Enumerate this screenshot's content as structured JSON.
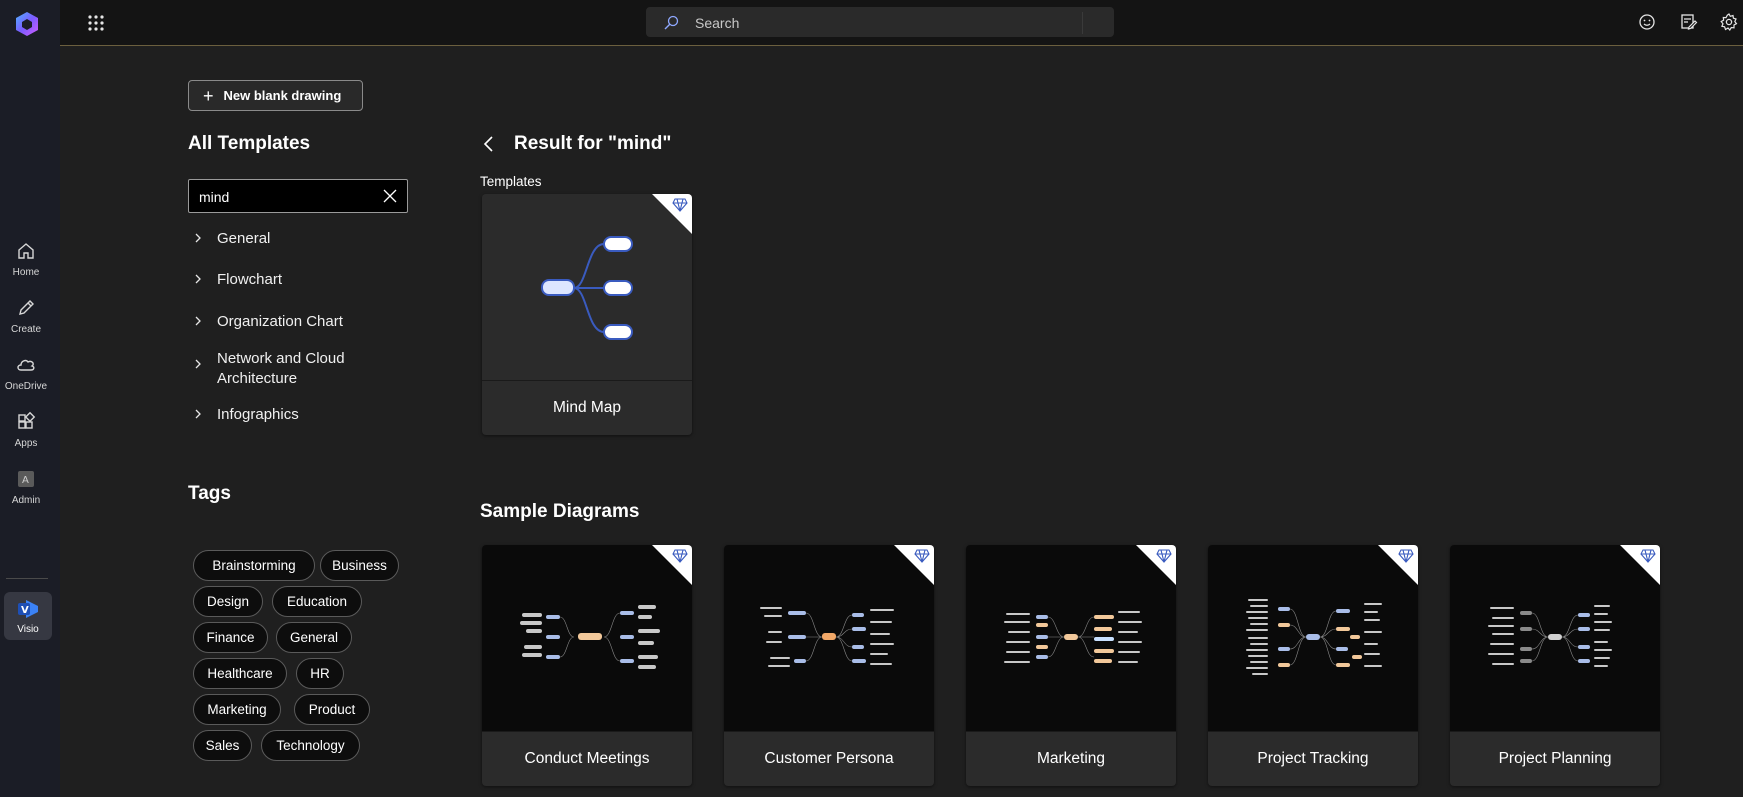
{
  "rail": {
    "items": [
      {
        "label": "Home",
        "icon": "home-icon"
      },
      {
        "label": "Create",
        "icon": "pencil-icon"
      },
      {
        "label": "OneDrive",
        "icon": "cloud-icon"
      },
      {
        "label": "Apps",
        "icon": "apps-icon"
      },
      {
        "label": "Admin",
        "icon": "admin-icon"
      }
    ],
    "active_app": {
      "label": "Visio",
      "icon": "visio-icon"
    }
  },
  "topbar": {
    "search_placeholder": "Search",
    "icons": [
      "feedback-smiley-icon",
      "notes-icon",
      "settings-icon"
    ]
  },
  "sidebar": {
    "new_button": "New blank drawing",
    "all_templates_title": "All Templates",
    "filter_value": "mind",
    "categories": [
      "General",
      "Flowchart",
      "Organization Chart",
      "Network and Cloud Architecture",
      "Infographics"
    ],
    "tags_title": "Tags",
    "tags": [
      "Brainstorming",
      "Business",
      "Design",
      "Education",
      "Finance",
      "General",
      "Healthcare",
      "HR",
      "Marketing",
      "Product",
      "Sales",
      "Technology"
    ]
  },
  "main": {
    "result_title": "Result for \"mind\"",
    "templates_label": "Templates",
    "templates": [
      {
        "name": "Mind Map",
        "premium": true
      }
    ],
    "samples_title": "Sample Diagrams",
    "samples": [
      {
        "name": "Conduct Meetings",
        "premium": true
      },
      {
        "name": "Customer Persona",
        "premium": true
      },
      {
        "name": "Marketing",
        "premium": true
      },
      {
        "name": "Project Tracking",
        "premium": true
      },
      {
        "name": "Project Planning",
        "premium": true
      }
    ]
  },
  "colors": {
    "background": "#1f1f1f",
    "rail": "#1b1d26",
    "topbar": "#141414",
    "accent_blue": "#3a5bbf",
    "node_fill": "#dde6ff"
  }
}
